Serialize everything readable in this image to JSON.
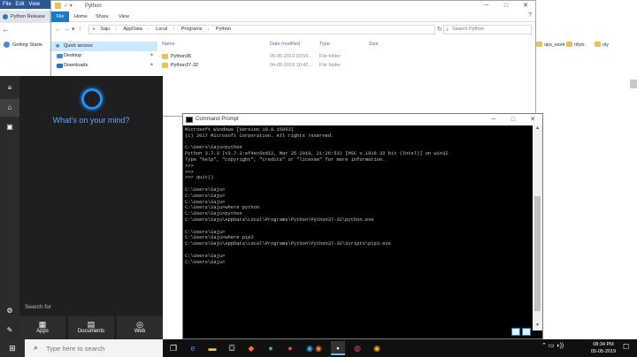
{
  "browser": {
    "menu": [
      "File",
      "Edit",
      "View"
    ],
    "tab_label": "Python Release",
    "bookmark": "Getting Starte",
    "bookmarks_right": [
      "ups_work",
      "nfyio",
      "nly"
    ]
  },
  "explorer": {
    "title": "Python",
    "ribbon": {
      "file": "File",
      "tabs": [
        "Home",
        "Share",
        "View"
      ]
    },
    "breadcrumb": [
      "Saju",
      "AppData",
      "Local",
      "Programs",
      "Python"
    ],
    "search_placeholder": "Search Python",
    "nav": [
      {
        "label": "Quick access",
        "icon": "star-icon"
      },
      {
        "label": "Desktop",
        "icon": "folder-icon"
      },
      {
        "label": "Downloads",
        "icon": "download-icon"
      }
    ],
    "columns": {
      "name": "Name",
      "date": "Date modified",
      "type": "Type",
      "size": "Size"
    },
    "files": [
      {
        "name": "Python36",
        "date": "05-05-2019 03:50...",
        "type": "File folder"
      },
      {
        "name": "Python37-32",
        "date": "04-05-2019 10:42...",
        "type": "File folder"
      }
    ]
  },
  "start_menu": {
    "prompt": "What's on your mind?",
    "search_for": "Search for",
    "tiles": [
      {
        "label": "Apps",
        "icon": "apps-icon"
      },
      {
        "label": "Documents",
        "icon": "document-icon"
      },
      {
        "label": "Web",
        "icon": "globe-icon"
      }
    ]
  },
  "cmd": {
    "title": "Command Prompt",
    "lines": [
      "Microsoft Windows [Version 10.0.15063]",
      "(c) 2017 Microsoft Corporation. All rights reserved.",
      "",
      "C:\\Users\\Saju>python",
      "Python 3.7.3 (v3.7.3:ef4ec6ed12, Mar 25 2019, 21:26:53) [MSC v.1916 32 bit (Intel)] on win32",
      "Type \"help\", \"copyright\", \"credits\" or \"license\" for more information.",
      ">>>",
      ">>>",
      ">>> quit()",
      "",
      "C:\\Users\\Saju>",
      "C:\\Users\\Saju>",
      "C:\\Users\\Saju>",
      "C:\\Users\\Saju>where python",
      "C:\\Users\\Saju>python",
      "C:\\Users\\Saju\\AppData\\Local\\Programs\\Python\\Python37-32\\python.exe",
      "",
      "C:\\Users\\Saju>",
      "C:\\Users\\Saju>where pip3",
      "C:\\Users\\Saju\\AppData\\Local\\Programs\\Python\\Python37-32\\Scripts\\pip3.exe",
      "",
      "C:\\Users\\Saju>",
      "C:\\Users\\Saju>"
    ]
  },
  "taskbar": {
    "search_placeholder": "Type here to search",
    "time": "08:34 PM",
    "date": "05-05-2019"
  },
  "colors": {
    "accent": "#1979ca",
    "cortana": "#1e90ff",
    "start_bg": "#1f1f1f"
  }
}
